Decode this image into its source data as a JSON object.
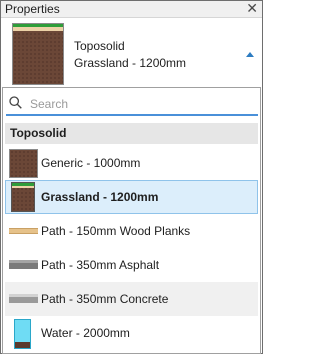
{
  "window": {
    "title": "Properties",
    "close_glyph": "✕"
  },
  "selector": {
    "category": "Toposolid",
    "type_name": "Grassland - 1200mm",
    "expand_icon": "triangle-up-icon"
  },
  "search": {
    "placeholder": "Search",
    "value": ""
  },
  "group": {
    "label": "Toposolid"
  },
  "items": [
    {
      "label": "Generic - 1000mm",
      "swatch": "generic-soil-swatch",
      "selected": false
    },
    {
      "label": "Grassland - 1200mm",
      "swatch": "grassland-swatch",
      "selected": true
    },
    {
      "label": "Path - 150mm Wood Planks",
      "swatch": "wood-planks-swatch",
      "selected": false
    },
    {
      "label": "Path - 350mm Asphalt",
      "swatch": "asphalt-swatch",
      "selected": false
    },
    {
      "label": "Path - 350mm Concrete",
      "swatch": "concrete-swatch",
      "selected": false
    },
    {
      "label": "Water - 2000mm",
      "swatch": "water-swatch",
      "selected": false
    }
  ],
  "colors": {
    "accent": "#4a90d9",
    "selected_bg": "#dceefb",
    "soil": "#6b4737",
    "grass": "#2f9d3a",
    "water": "#6fdcf4"
  }
}
